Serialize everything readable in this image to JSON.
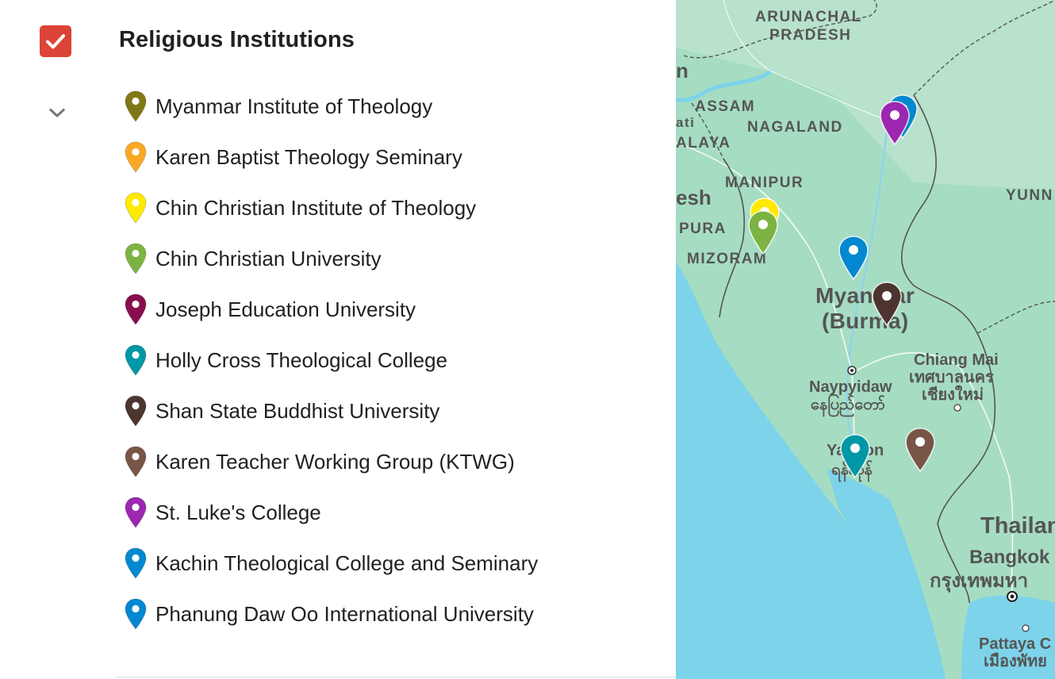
{
  "layer": {
    "title": "Religious Institutions",
    "checked": true,
    "check_color": "#db4437"
  },
  "items": [
    {
      "label": "Myanmar Institute of Theology",
      "color": "#827717"
    },
    {
      "label": "Karen Baptist Theology Seminary",
      "color": "#f9a825"
    },
    {
      "label": "Chin Christian Institute of Theology",
      "color": "#ffea00"
    },
    {
      "label": "Chin Christian University",
      "color": "#7cb342"
    },
    {
      "label": "Joseph Education University",
      "color": "#880e4f"
    },
    {
      "label": "Holly Cross Theological College",
      "color": "#0097a7"
    },
    {
      "label": "Shan State Buddhist University",
      "color": "#4e342e"
    },
    {
      "label": "Karen Teacher Working Group (KTWG)",
      "color": "#795548"
    },
    {
      "label": "St. Luke's College",
      "color": "#9c27b0"
    },
    {
      "label": "Kachin Theological College and Seminary",
      "color": "#0288d1"
    },
    {
      "label": "Phanung Daw Oo International University",
      "color": "#0288d1"
    }
  ],
  "map": {
    "labels": {
      "arunachal": "ARUNACHAL",
      "pradesh": "PRADESH",
      "assam": "ASSAM",
      "nagaland": "NAGALAND",
      "ghalaya": "ALAYA",
      "tip": "ati",
      "manipur": "MANIPUR",
      "desh": "esh",
      "tripura": "PURA",
      "mizoram": "MIZORAM",
      "yunnan": "YUNN",
      "myanmar1": "Myanmar",
      "myanmar2": "(Burma)",
      "chiangmai": "Chiang Mai",
      "chiangmai_th1": "เทศบาลนคร",
      "chiangmai_th2": "เชียงใหม่",
      "naypyidaw": "Naypyidaw",
      "naypyidaw_my": "နေပြည်တော်",
      "yangon": "Yangon",
      "yangon_my": "ရန်ကုန်",
      "thailand": "Thailan",
      "bangkok": "Bangkok",
      "bangkok_th": "กรุงเทพมหา",
      "pattaya": "Pattaya C",
      "pattaya_th": "เมืองพัทย",
      "n_edge": "n"
    },
    "colors": {
      "land": "#9fdcc0",
      "water": "#7dd3ea",
      "border": "#555555",
      "road": "#ffffff"
    },
    "markers": [
      {
        "name": "kachin-marker",
        "color": "#0288d1"
      },
      {
        "name": "st-lukes-marker",
        "color": "#9c27b0"
      },
      {
        "name": "chin-institute-marker",
        "color": "#ffea00"
      },
      {
        "name": "chin-university-marker",
        "color": "#7cb342"
      },
      {
        "name": "phanung-marker",
        "color": "#0288d1"
      },
      {
        "name": "shan-state-marker",
        "color": "#4e342e"
      },
      {
        "name": "holly-cross-marker",
        "color": "#0097a7"
      },
      {
        "name": "ktwg-marker",
        "color": "#795548"
      }
    ]
  }
}
